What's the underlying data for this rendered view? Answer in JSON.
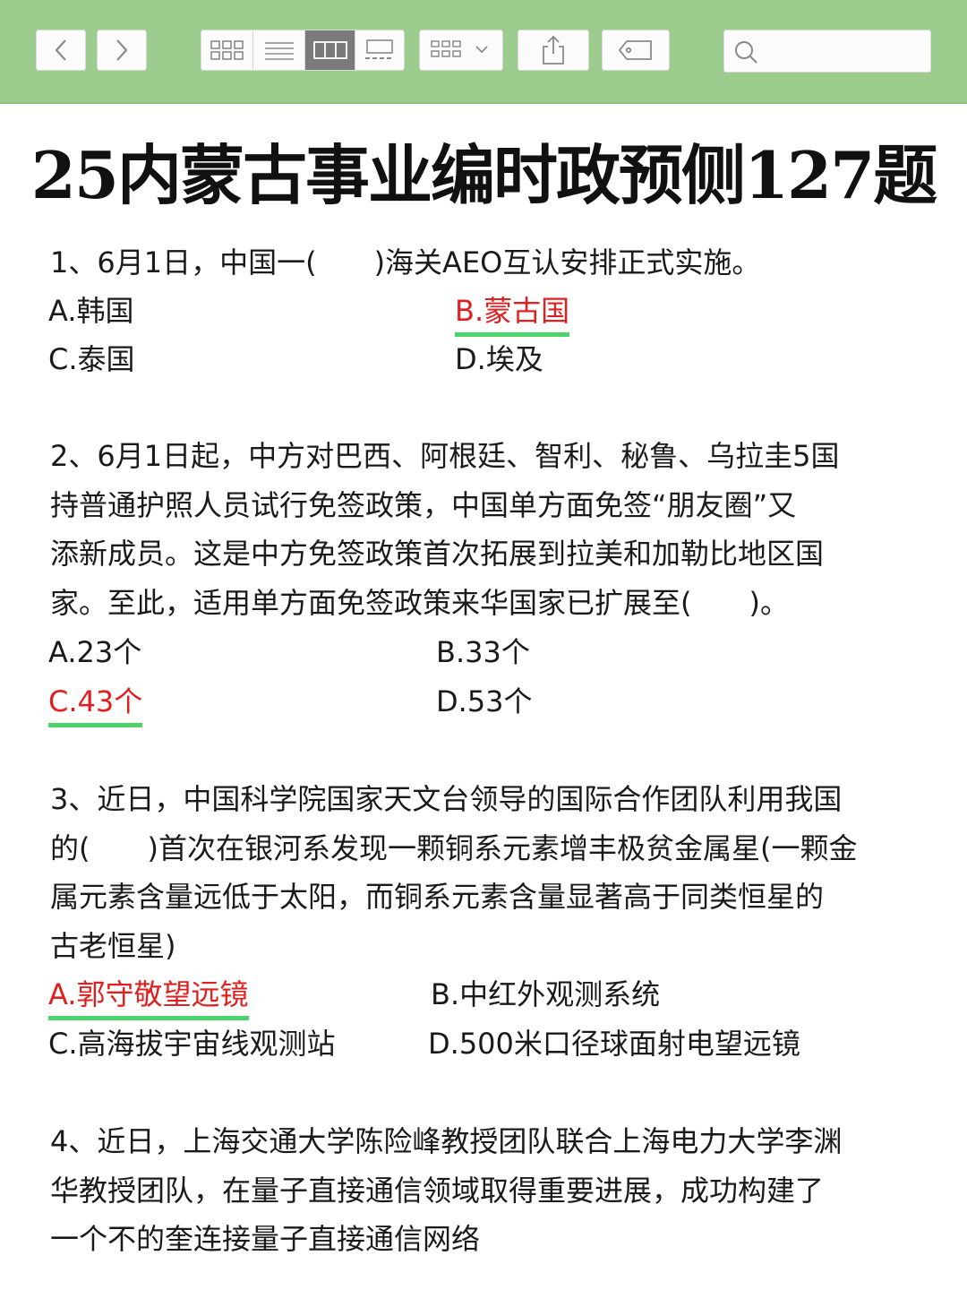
{
  "title": "25内蒙古事业编时政预侧127题",
  "colors": {
    "toolbar_bg": "#9ccc8e",
    "correct_text": "#e02020",
    "correct_underline": "#4cd46b"
  },
  "toolbar": {
    "icons": [
      "chevron-left-icon",
      "chevron-right-icon",
      "grid-view-icon",
      "list-view-icon",
      "column-view-icon",
      "gallery-view-icon",
      "group-menu-icon",
      "share-icon",
      "tag-icon",
      "search-icon"
    ],
    "search_placeholder": ""
  },
  "questions": [
    {
      "lines": [
        "1、6月1日，中国一(　　)海关AEO互认安排正式实施。"
      ],
      "options": [
        {
          "text": "A.韩国",
          "correct": false
        },
        {
          "text": "B.蒙古国",
          "correct": true
        },
        {
          "text": "C.泰国",
          "correct": false
        },
        {
          "text": "D.埃及",
          "correct": false
        }
      ]
    },
    {
      "lines": [
        "2、6月1日起，中方对巴西、阿根廷、智利、秘鲁、乌拉圭5国",
        "持普通护照人员试行免签政策，中国单方面免签“朋友圈”又",
        "添新成员。这是中方免签政策首次拓展到拉美和加勒比地区国",
        "家。至此，适用单方面免签政策来华国家已扩展至(　　)。"
      ],
      "options": [
        {
          "text": "A.23个",
          "correct": false
        },
        {
          "text": "B.33个",
          "correct": false
        },
        {
          "text": "C.43个",
          "correct": true
        },
        {
          "text": "D.53个",
          "correct": false
        }
      ]
    },
    {
      "lines": [
        "3、近日，中国科学院国家天文台领导的国际合作团队利用我国",
        "的(　　)首次在银河系发现一颗铜系元素增丰极贫金属星(一颗金",
        "属元素含量远低于太阳，而铜系元素含量显著高于同类恒星的",
        "古老恒星)"
      ],
      "options": [
        {
          "text": "A.郭守敬望远镜",
          "correct": true
        },
        {
          "text": "B.中红外观测系统",
          "correct": false
        },
        {
          "text": "C.高海拔宇宙线观测站",
          "correct": false
        },
        {
          "text": "D.500米口径球面射电望远镜",
          "correct": false
        }
      ]
    },
    {
      "lines": [
        "4、近日，上海交通大学陈险峰教授团队联合上海电力大学李渊",
        "华教授团队，在量子直接通信领域取得重要进展，成功构建了",
        "一个不的奎连接量子直接通信网络"
      ],
      "options": []
    }
  ]
}
